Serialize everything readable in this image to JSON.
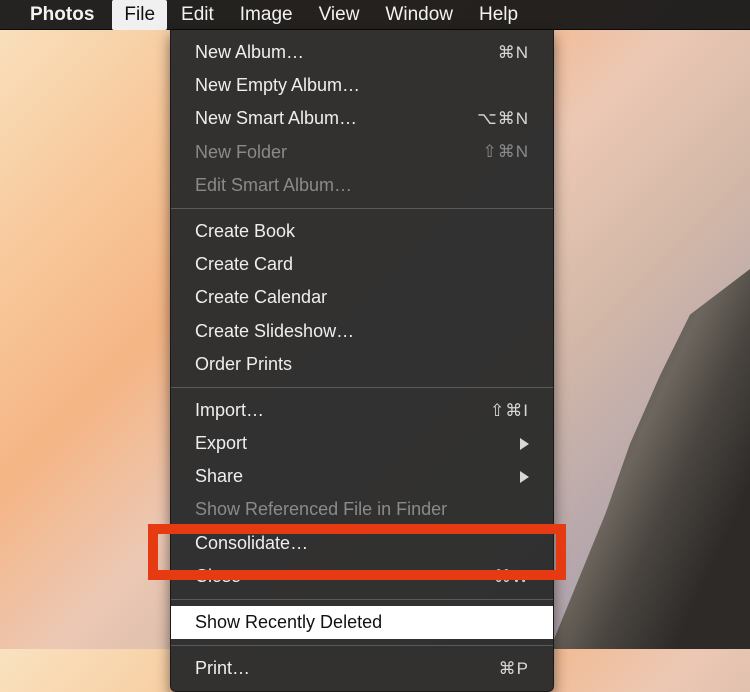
{
  "menubar": {
    "app": "Photos",
    "items": [
      "File",
      "Edit",
      "Image",
      "View",
      "Window",
      "Help"
    ],
    "active_index": 0
  },
  "menu": {
    "group1": [
      {
        "label": "New Album…",
        "shortcut": "⌘N",
        "disabled": false
      },
      {
        "label": "New Empty Album…",
        "shortcut": "",
        "disabled": false
      },
      {
        "label": "New Smart Album…",
        "shortcut": "⌥⌘N",
        "disabled": false
      },
      {
        "label": "New Folder",
        "shortcut": "⇧⌘N",
        "disabled": true
      },
      {
        "label": "Edit Smart Album…",
        "shortcut": "",
        "disabled": true
      }
    ],
    "group2": [
      {
        "label": "Create Book"
      },
      {
        "label": "Create Card"
      },
      {
        "label": "Create Calendar"
      },
      {
        "label": "Create Slideshow…"
      },
      {
        "label": "Order Prints"
      }
    ],
    "group3": [
      {
        "label": "Import…",
        "shortcut": "⇧⌘I"
      },
      {
        "label": "Export",
        "submenu": true
      },
      {
        "label": "Share",
        "submenu": true
      },
      {
        "label": "Show Referenced File in Finder",
        "disabled": true
      },
      {
        "label": "Consolidate…"
      },
      {
        "label": "Close",
        "shortcut": "⌘W"
      }
    ],
    "group4": [
      {
        "label": "Show Recently Deleted",
        "highlighted": true
      }
    ],
    "group5": [
      {
        "label": "Print…",
        "shortcut": "⌘P"
      }
    ]
  }
}
